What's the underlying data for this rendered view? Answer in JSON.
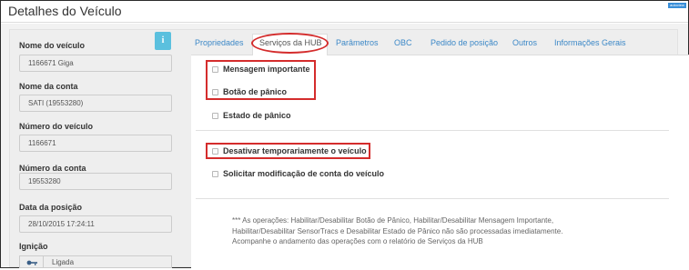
{
  "window": {
    "title": "Detalhes do Veículo",
    "corner_tag": "autoview"
  },
  "sidebar": {
    "info_button": "i",
    "fields": [
      {
        "label": "Nome do veículo",
        "value": "1166671 Giga"
      },
      {
        "label": "Nome da conta",
        "value": "SATI (19553280)"
      },
      {
        "label": "Número do veículo",
        "value": "1166671"
      },
      {
        "label": "Número da conta",
        "value": "19553280"
      },
      {
        "label": "Data da posição",
        "value": "28/10/2015 17:24:11"
      }
    ],
    "ignition": {
      "label": "Ignição",
      "icon": "key-icon",
      "value": "Ligada"
    }
  },
  "tabs": [
    {
      "label": "Propriedades"
    },
    {
      "label": "Serviços da HUB",
      "active": true
    },
    {
      "label": "Parâmetros"
    },
    {
      "label": "OBC"
    },
    {
      "label": "Pedido de posição"
    },
    {
      "label": "Outros"
    },
    {
      "label": "Informações Gerais"
    }
  ],
  "services": {
    "checkboxes": [
      {
        "label": "Mensagem importante",
        "checked": false
      },
      {
        "label": "Botão de pânico",
        "checked": false
      },
      {
        "label": "Estado de pânico",
        "checked": false
      },
      {
        "label": "Desativar temporariamente o veículo",
        "checked": false
      },
      {
        "label": "Solicitar modificação de conta do veículo",
        "checked": false
      }
    ],
    "note_lines": [
      "*** As operações: Habilitar/Desabilitar Botão de Pânico, Habilitar/Desabilitar Mensagem Importante,",
      "Habilitar/Desabilitar SensorTracs e Desabilitar Estado de Pânico não são processadas imediatamente.",
      "Acompanhe o andamento das operações com o relatório de Serviços da HUB"
    ]
  },
  "colors": {
    "highlight": "#d42c2c",
    "tab_link": "#3c88c7",
    "info_button": "#5bc0de"
  }
}
